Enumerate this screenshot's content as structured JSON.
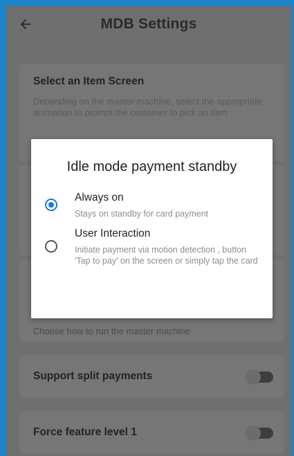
{
  "header": {
    "title": "MDB Settings",
    "back_icon": "arrow-left-icon"
  },
  "settings": {
    "select_item_screen": {
      "title": "Select an Item Screen",
      "description": "Depending on the master machine, select the appropriate animation to prompt the customer to pick an item"
    },
    "partially_hidden_text": "Choose how to run the master machine",
    "support_split_payments": {
      "label": "Support split payments",
      "enabled": false
    },
    "force_feature_level_1": {
      "label": "Force feature level 1",
      "enabled": false
    }
  },
  "dialog": {
    "title": "Idle mode payment standby",
    "options": [
      {
        "label": "Always on",
        "description": "Stays on standby for card payment",
        "selected": true
      },
      {
        "label": "User Interaction",
        "description": "Initiate payment via motion detection , button 'Tap to pay' on the screen or simply tap the card",
        "selected": false
      }
    ]
  },
  "colors": {
    "frame_border": "#1e84c8",
    "accent_radio": "#1e78d6",
    "overlay_bg": "#6f6f6f"
  }
}
